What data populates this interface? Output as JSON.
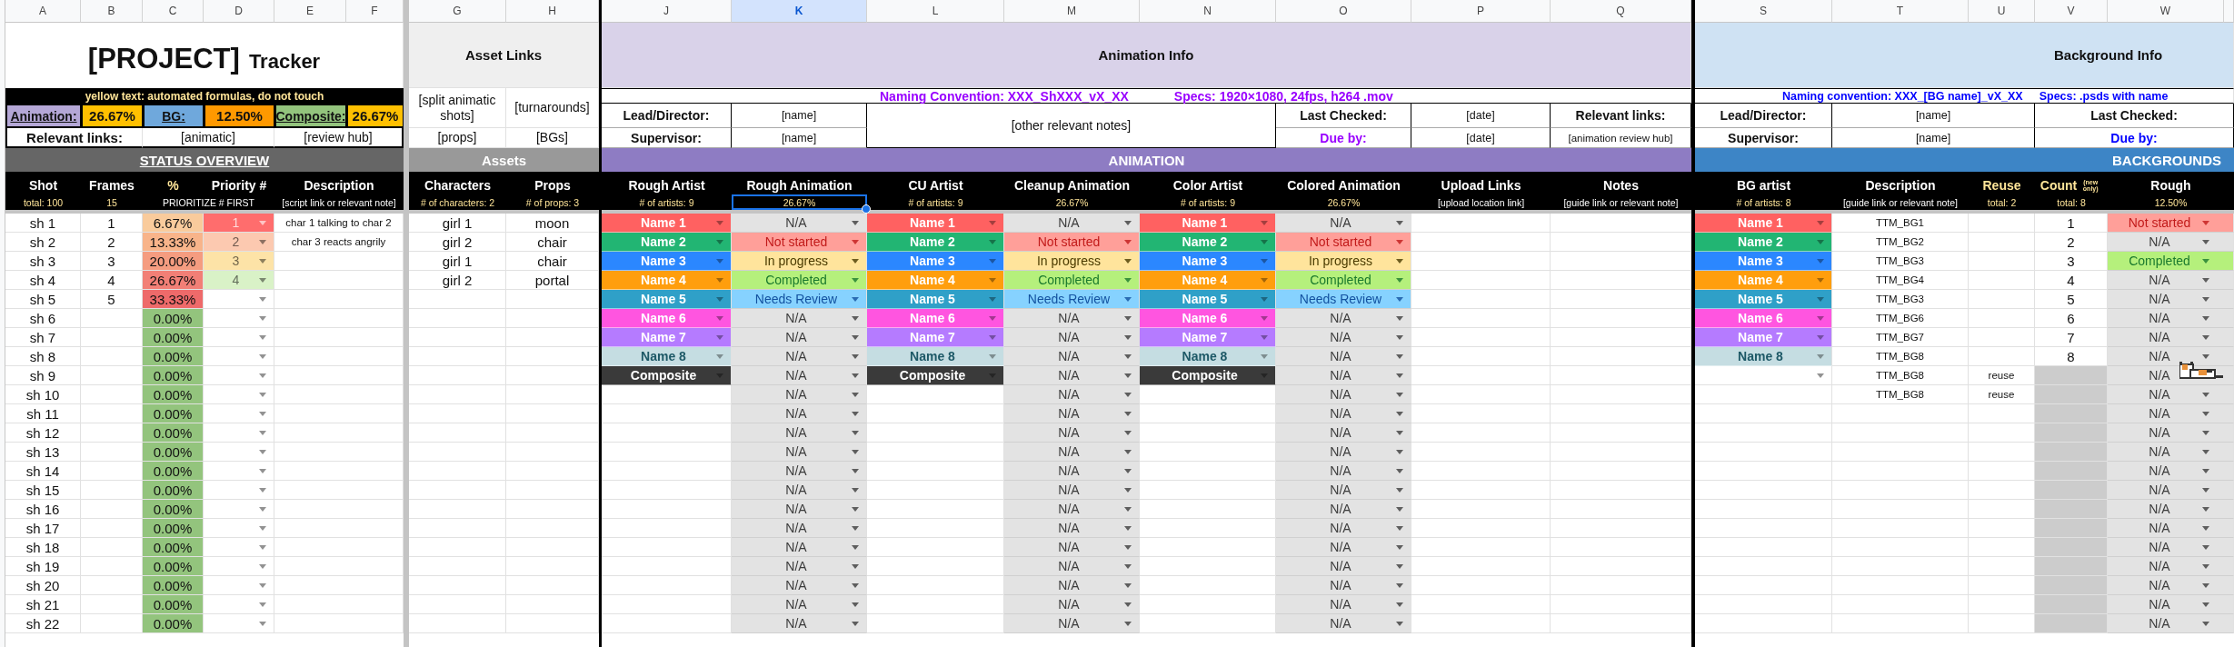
{
  "column_headers": [
    {
      "label": "A",
      "selected": false
    },
    {
      "label": "B",
      "selected": false
    },
    {
      "label": "C",
      "selected": false
    },
    {
      "label": "D",
      "selected": false
    },
    {
      "label": "E",
      "selected": false
    },
    {
      "label": "F",
      "selected": false
    },
    {
      "label": "G",
      "selected": false
    },
    {
      "label": "H",
      "selected": false
    },
    {
      "label": "J",
      "selected": false
    },
    {
      "label": "K",
      "selected": true
    },
    {
      "label": "L",
      "selected": false
    },
    {
      "label": "M",
      "selected": false
    },
    {
      "label": "N",
      "selected": false
    },
    {
      "label": "O",
      "selected": false
    },
    {
      "label": "P",
      "selected": false
    },
    {
      "label": "Q",
      "selected": false
    },
    {
      "label": "S",
      "selected": false
    },
    {
      "label": "T",
      "selected": false
    },
    {
      "label": "U",
      "selected": false
    },
    {
      "label": "V",
      "selected": false
    },
    {
      "label": "W",
      "selected": false
    }
  ],
  "tracker": {
    "title": "[PROJECT]",
    "subtitle": "Tracker",
    "notice": "yellow text: automated formulas, do not touch",
    "progress": [
      {
        "kind": "label",
        "text": "Animation:",
        "color": "#b4a7d6"
      },
      {
        "kind": "value",
        "text": "26.67%",
        "color": "#ffc000"
      },
      {
        "kind": "label",
        "text": "BG:",
        "color": "#6fa8dc"
      },
      {
        "kind": "value",
        "text": "12.50%",
        "color": "#ff9900"
      },
      {
        "kind": "label",
        "text": "Composite:",
        "color": "#93c47d"
      },
      {
        "kind": "value",
        "text": "26.67%",
        "color": "#ffc000"
      }
    ],
    "links_label": "Relevant links:",
    "links": [
      "[animatic]",
      "[review hub]"
    ],
    "section": "STATUS OVERVIEW",
    "headers": [
      {
        "title": "Shot",
        "formula": false
      },
      {
        "title": "Frames",
        "formula": false
      },
      {
        "title": "%",
        "formula": true
      },
      {
        "title": "Priority #",
        "formula": false
      },
      {
        "title": "Description",
        "formula": false
      }
    ],
    "subheaders": [
      {
        "text": "total: 100",
        "formula": true
      },
      {
        "text": "15",
        "formula": true
      },
      {
        "text": "PRIORITIZE # FIRST",
        "formula": false
      },
      {
        "text": "[script link or relevant note]",
        "formula": false
      }
    ]
  },
  "assets": {
    "title": "Asset Links",
    "links": [
      "[split animatic shots]",
      "[turnarounds]",
      "[props]",
      "[BGs]"
    ],
    "section": "Assets",
    "headers": [
      {
        "title": "Characters",
        "formula": false
      },
      {
        "title": "Props",
        "formula": false
      }
    ],
    "subheaders": [
      {
        "text": "# of characters: 2",
        "formula": true
      },
      {
        "text": "# of props: 3",
        "formula": true
      }
    ]
  },
  "animation": {
    "title": "Animation Info",
    "naming": "Naming Convention: XXX_ShXXX_vX_XX",
    "specs": "Specs: 1920×1080, 24fps, h264 .mov",
    "lead_label": "Lead/Director:",
    "lead": "[name]",
    "notes": "[other relevant notes]",
    "last_checked_label": "Last Checked:",
    "last_checked": "[date]",
    "links_label": "Relevant links:",
    "supervisor_label": "Supervisor:",
    "supervisor": "[name]",
    "due_label": "Due by:",
    "due": "[date]",
    "links": "[animation review hub]",
    "section": "ANIMATION",
    "headers": [
      {
        "title": "Rough Artist",
        "formula": false
      },
      {
        "title": "Rough Animation",
        "formula": false
      },
      {
        "title": "CU Artist",
        "formula": false
      },
      {
        "title": "Cleanup Animation",
        "formula": false
      },
      {
        "title": "Color Artist",
        "formula": false
      },
      {
        "title": "Colored Animation",
        "formula": false
      },
      {
        "title": "Upload Links",
        "formula": false
      },
      {
        "title": "Notes",
        "formula": false
      }
    ],
    "subheaders": [
      {
        "text": "# of artists: 9",
        "formula": true
      },
      {
        "text": "26.67%",
        "formula": true
      },
      {
        "text": "# of artists: 9",
        "formula": true
      },
      {
        "text": "26.67%",
        "formula": true
      },
      {
        "text": "# of artists: 9",
        "formula": true
      },
      {
        "text": "26.67%",
        "formula": true
      },
      {
        "text": "[upload location link]",
        "formula": false
      },
      {
        "text": "[guide link or relevant note]",
        "formula": false
      }
    ]
  },
  "background": {
    "title": "Background Info",
    "naming": "Naming convention: XXX_[BG name]_vX_XX",
    "specs": "Specs: .psds with name",
    "lead_label": "Lead/Director:",
    "lead": "[name]",
    "last_checked_label": "Last Checked:",
    "supervisor_label": "Supervisor:",
    "supervisor": "[name]",
    "due_label": "Due by:",
    "section": "BACKGROUNDS",
    "headers": [
      {
        "title": "BG artist",
        "formula": false
      },
      {
        "title": "Description",
        "formula": false
      },
      {
        "title": "Reuse",
        "formula": true
      },
      {
        "title": "Count",
        "note": "(new only)",
        "formula": true
      },
      {
        "title": "Rough",
        "formula": false
      }
    ],
    "subheaders": [
      {
        "text": "# of artists: 8",
        "formula": true
      },
      {
        "text": "[guide link or relevant note]",
        "formula": false
      },
      {
        "text": "total: 2",
        "formula": true
      },
      {
        "text": "total: 8",
        "formula": true
      },
      {
        "text": "12.50%",
        "formula": true
      }
    ]
  },
  "rows": [
    {
      "shot": "sh 1",
      "frames": "1",
      "percent": {
        "text": "6.67%",
        "color": "#f9cb9c"
      },
      "priority": {
        "text": "1",
        "color": "#ff6d6d"
      },
      "description": "char 1 talking to char 2",
      "character": "girl 1",
      "prop": "moon",
      "anim": [
        {
          "kind": "artist",
          "text": "Name 1",
          "color": "#ff6161"
        },
        {
          "kind": "na",
          "text": "N/A"
        },
        {
          "kind": "artist",
          "text": "Name 1",
          "color": "#ff6161"
        },
        {
          "kind": "na",
          "text": "N/A"
        },
        {
          "kind": "artist",
          "text": "Name 1",
          "color": "#ff6161"
        },
        {
          "kind": "na",
          "text": "N/A"
        }
      ],
      "bg": {
        "artist": {
          "kind": "artist",
          "text": "Name 1",
          "color": "#ff6161"
        },
        "description": "TTM_BG1",
        "count": "1",
        "rough": {
          "kind": "not_started",
          "text": "Not started"
        }
      }
    },
    {
      "shot": "sh 2",
      "frames": "2",
      "percent": {
        "text": "13.33%",
        "color": "#f8b48a"
      },
      "priority": {
        "text": "2",
        "color": "#fcc9b0"
      },
      "description": "char 3 reacts angrily",
      "character": "girl 2",
      "prop": "chair",
      "anim": [
        {
          "kind": "artist",
          "text": "Name 2",
          "color": "#22b573"
        },
        {
          "kind": "not_started",
          "text": "Not started"
        },
        {
          "kind": "artist",
          "text": "Name 2",
          "color": "#22b573"
        },
        {
          "kind": "not_started",
          "text": "Not started"
        },
        {
          "kind": "artist",
          "text": "Name 2",
          "color": "#22b573"
        },
        {
          "kind": "not_started",
          "text": "Not started"
        }
      ],
      "bg": {
        "artist": {
          "kind": "artist",
          "text": "Name 2",
          "color": "#22b573"
        },
        "description": "TTM_BG2",
        "count": "2",
        "rough": {
          "kind": "na",
          "text": "N/A"
        }
      }
    },
    {
      "shot": "sh 3",
      "frames": "3",
      "percent": {
        "text": "20.00%",
        "color": "#f59c80"
      },
      "priority": {
        "text": "3",
        "color": "#fde3a7"
      },
      "character": "girl 1",
      "prop": "chair",
      "anim": [
        {
          "kind": "artist",
          "text": "Name 3",
          "color": "#2b87ff"
        },
        {
          "kind": "in_progress",
          "text": "In progress"
        },
        {
          "kind": "artist",
          "text": "Name 3",
          "color": "#2b87ff"
        },
        {
          "kind": "in_progress",
          "text": "In progress"
        },
        {
          "kind": "artist",
          "text": "Name 3",
          "color": "#2b87ff"
        },
        {
          "kind": "in_progress",
          "text": "In progress"
        }
      ],
      "bg": {
        "artist": {
          "kind": "artist",
          "text": "Name 3",
          "color": "#2b87ff"
        },
        "description": "TTM_BG3",
        "count": "3",
        "rough": {
          "kind": "completed",
          "text": "Completed"
        }
      }
    },
    {
      "shot": "sh 4",
      "frames": "4",
      "percent": {
        "text": "26.67%",
        "color": "#f27f76"
      },
      "priority": {
        "text": "4",
        "color": "#d9f2c7"
      },
      "character": "girl 2",
      "prop": "portal",
      "anim": [
        {
          "kind": "artist",
          "text": "Name 4",
          "color": "#ff9e0d"
        },
        {
          "kind": "completed",
          "text": "Completed"
        },
        {
          "kind": "artist",
          "text": "Name 4",
          "color": "#ff9e0d"
        },
        {
          "kind": "completed",
          "text": "Completed"
        },
        {
          "kind": "artist",
          "text": "Name 4",
          "color": "#ff9e0d"
        },
        {
          "kind": "completed",
          "text": "Completed"
        }
      ],
      "bg": {
        "artist": {
          "kind": "artist",
          "text": "Name 4",
          "color": "#ff9e0d"
        },
        "description": "TTM_BG4",
        "count": "4",
        "rough": {
          "kind": "na",
          "text": "N/A"
        }
      }
    },
    {
      "shot": "sh 5",
      "frames": "5",
      "percent": {
        "text": "33.33%",
        "color": "#ee6a6a"
      },
      "anim": [
        {
          "kind": "artist",
          "text": "Name 5",
          "color": "#2fa0c8"
        },
        {
          "kind": "needs_review",
          "text": "Needs Review"
        },
        {
          "kind": "artist",
          "text": "Name 5",
          "color": "#2fa0c8"
        },
        {
          "kind": "needs_review",
          "text": "Needs Review"
        },
        {
          "kind": "artist",
          "text": "Name 5",
          "color": "#2fa0c8"
        },
        {
          "kind": "needs_review",
          "text": "Needs Review"
        }
      ],
      "bg": {
        "artist": {
          "kind": "artist",
          "text": "Name 5",
          "color": "#2fa0c8"
        },
        "description": "TTM_BG3",
        "count": "5",
        "rough": {
          "kind": "na",
          "text": "N/A"
        }
      }
    },
    {
      "shot": "sh 6",
      "percent": {
        "text": "0.00%",
        "color": "#93c47d"
      },
      "anim": [
        {
          "kind": "artist",
          "text": "Name 6",
          "color": "#ff55e0"
        },
        {
          "kind": "na",
          "text": "N/A"
        },
        {
          "kind": "artist",
          "text": "Name 6",
          "color": "#ff55e0"
        },
        {
          "kind": "na",
          "text": "N/A"
        },
        {
          "kind": "artist",
          "text": "Name 6",
          "color": "#ff55e0"
        },
        {
          "kind": "na",
          "text": "N/A"
        }
      ],
      "bg": {
        "artist": {
          "kind": "artist",
          "text": "Name 6",
          "color": "#ff55e0"
        },
        "description": "TTM_BG6",
        "count": "6",
        "rough": {
          "kind": "na",
          "text": "N/A"
        }
      }
    },
    {
      "shot": "sh 7",
      "percent": {
        "text": "0.00%",
        "color": "#93c47d"
      },
      "anim": [
        {
          "kind": "artist",
          "text": "Name 7",
          "color": "#b57bff"
        },
        {
          "kind": "na",
          "text": "N/A"
        },
        {
          "kind": "artist",
          "text": "Name 7",
          "color": "#b57bff"
        },
        {
          "kind": "na",
          "text": "N/A"
        },
        {
          "kind": "artist",
          "text": "Name 7",
          "color": "#b57bff"
        },
        {
          "kind": "na",
          "text": "N/A"
        }
      ],
      "bg": {
        "artist": {
          "kind": "artist",
          "text": "Name 7",
          "color": "#b57bff"
        },
        "description": "TTM_BG7",
        "count": "7",
        "rough": {
          "kind": "na",
          "text": "N/A"
        }
      }
    },
    {
      "shot": "sh 8",
      "percent": {
        "text": "0.00%",
        "color": "#93c47d"
      },
      "anim": [
        {
          "kind": "artist",
          "text": "Name 8",
          "color": "#c5dde2"
        },
        {
          "kind": "na",
          "text": "N/A"
        },
        {
          "kind": "artist",
          "text": "Name 8",
          "color": "#c5dde2"
        },
        {
          "kind": "na",
          "text": "N/A"
        },
        {
          "kind": "artist",
          "text": "Name 8",
          "color": "#c5dde2"
        },
        {
          "kind": "na",
          "text": "N/A"
        }
      ],
      "bg": {
        "artist": {
          "kind": "artist",
          "text": "Name 8",
          "color": "#c5dde2"
        },
        "description": "TTM_BG8",
        "count": "8",
        "rough": {
          "kind": "na",
          "text": "N/A"
        }
      }
    },
    {
      "shot": "sh 9",
      "percent": {
        "text": "0.00%",
        "color": "#93c47d"
      },
      "anim": [
        {
          "kind": "artist",
          "text": "Composite",
          "color": "#3a3a3a"
        },
        {
          "kind": "na",
          "text": "N/A"
        },
        {
          "kind": "artist",
          "text": "Composite",
          "color": "#3a3a3a"
        },
        {
          "kind": "na",
          "text": "N/A"
        },
        {
          "kind": "artist",
          "text": "Composite",
          "color": "#3a3a3a"
        },
        {
          "kind": "na",
          "text": "N/A"
        }
      ],
      "bg": {
        "artist": {
          "kind": "dropdown"
        },
        "description": "TTM_BG8",
        "reuse": "reuse",
        "rough": {
          "kind": "na",
          "text": "N/A"
        }
      }
    },
    {
      "shot": "sh 10",
      "percent": {
        "text": "0.00%",
        "color": "#93c47d"
      },
      "anim": [
        {
          "kind": "blank"
        },
        {
          "kind": "na",
          "text": "N/A"
        },
        {
          "kind": "blank"
        },
        {
          "kind": "na",
          "text": "N/A"
        },
        {
          "kind": "blank"
        },
        {
          "kind": "na",
          "text": "N/A"
        }
      ],
      "bg": {
        "description": "TTM_BG8",
        "reuse": "reuse",
        "rough": {
          "kind": "na",
          "text": "N/A"
        }
      }
    },
    {
      "shot": "sh 11",
      "percent": {
        "text": "0.00%",
        "color": "#93c47d"
      },
      "anim": [
        {
          "kind": "blank"
        },
        {
          "kind": "na",
          "text": "N/A"
        },
        {
          "kind": "blank"
        },
        {
          "kind": "na",
          "text": "N/A"
        },
        {
          "kind": "blank"
        },
        {
          "kind": "na",
          "text": "N/A"
        }
      ],
      "bg": {
        "rough": {
          "kind": "na",
          "text": "N/A"
        }
      }
    },
    {
      "shot": "sh 12",
      "percent": {
        "text": "0.00%",
        "color": "#93c47d"
      },
      "anim": [
        {
          "kind": "blank"
        },
        {
          "kind": "na",
          "text": "N/A"
        },
        {
          "kind": "blank"
        },
        {
          "kind": "na",
          "text": "N/A"
        },
        {
          "kind": "blank"
        },
        {
          "kind": "na",
          "text": "N/A"
        }
      ],
      "bg": {
        "rough": {
          "kind": "na",
          "text": "N/A"
        }
      }
    },
    {
      "shot": "sh 13",
      "percent": {
        "text": "0.00%",
        "color": "#93c47d"
      },
      "anim": [
        {
          "kind": "blank"
        },
        {
          "kind": "na",
          "text": "N/A"
        },
        {
          "kind": "blank"
        },
        {
          "kind": "na",
          "text": "N/A"
        },
        {
          "kind": "blank"
        },
        {
          "kind": "na",
          "text": "N/A"
        }
      ],
      "bg": {
        "rough": {
          "kind": "na",
          "text": "N/A"
        }
      }
    },
    {
      "shot": "sh 14",
      "percent": {
        "text": "0.00%",
        "color": "#93c47d"
      },
      "anim": [
        {
          "kind": "blank"
        },
        {
          "kind": "na",
          "text": "N/A"
        },
        {
          "kind": "blank"
        },
        {
          "kind": "na",
          "text": "N/A"
        },
        {
          "kind": "blank"
        },
        {
          "kind": "na",
          "text": "N/A"
        }
      ],
      "bg": {
        "rough": {
          "kind": "na",
          "text": "N/A"
        }
      }
    },
    {
      "shot": "sh 15",
      "percent": {
        "text": "0.00%",
        "color": "#93c47d"
      },
      "anim": [
        {
          "kind": "blank"
        },
        {
          "kind": "na",
          "text": "N/A"
        },
        {
          "kind": "blank"
        },
        {
          "kind": "na",
          "text": "N/A"
        },
        {
          "kind": "blank"
        },
        {
          "kind": "na",
          "text": "N/A"
        }
      ],
      "bg": {
        "rough": {
          "kind": "na",
          "text": "N/A"
        }
      }
    },
    {
      "shot": "sh 16",
      "percent": {
        "text": "0.00%",
        "color": "#93c47d"
      },
      "anim": [
        {
          "kind": "blank"
        },
        {
          "kind": "na",
          "text": "N/A"
        },
        {
          "kind": "blank"
        },
        {
          "kind": "na",
          "text": "N/A"
        },
        {
          "kind": "blank"
        },
        {
          "kind": "na",
          "text": "N/A"
        }
      ],
      "bg": {
        "rough": {
          "kind": "na",
          "text": "N/A"
        }
      }
    },
    {
      "shot": "sh 17",
      "percent": {
        "text": "0.00%",
        "color": "#93c47d"
      },
      "anim": [
        {
          "kind": "blank"
        },
        {
          "kind": "na",
          "text": "N/A"
        },
        {
          "kind": "blank"
        },
        {
          "kind": "na",
          "text": "N/A"
        },
        {
          "kind": "blank"
        },
        {
          "kind": "na",
          "text": "N/A"
        }
      ],
      "bg": {
        "rough": {
          "kind": "na",
          "text": "N/A"
        }
      }
    },
    {
      "shot": "sh 18",
      "percent": {
        "text": "0.00%",
        "color": "#93c47d"
      },
      "anim": [
        {
          "kind": "blank"
        },
        {
          "kind": "na",
          "text": "N/A"
        },
        {
          "kind": "blank"
        },
        {
          "kind": "na",
          "text": "N/A"
        },
        {
          "kind": "blank"
        },
        {
          "kind": "na",
          "text": "N/A"
        }
      ],
      "bg": {
        "rough": {
          "kind": "na",
          "text": "N/A"
        }
      }
    },
    {
      "shot": "sh 19",
      "percent": {
        "text": "0.00%",
        "color": "#93c47d"
      },
      "anim": [
        {
          "kind": "blank"
        },
        {
          "kind": "na",
          "text": "N/A"
        },
        {
          "kind": "blank"
        },
        {
          "kind": "na",
          "text": "N/A"
        },
        {
          "kind": "blank"
        },
        {
          "kind": "na",
          "text": "N/A"
        }
      ],
      "bg": {
        "rough": {
          "kind": "na",
          "text": "N/A"
        }
      }
    },
    {
      "shot": "sh 20",
      "percent": {
        "text": "0.00%",
        "color": "#93c47d"
      },
      "anim": [
        {
          "kind": "blank"
        },
        {
          "kind": "na",
          "text": "N/A"
        },
        {
          "kind": "blank"
        },
        {
          "kind": "na",
          "text": "N/A"
        },
        {
          "kind": "blank"
        },
        {
          "kind": "na",
          "text": "N/A"
        }
      ],
      "bg": {
        "rough": {
          "kind": "na",
          "text": "N/A"
        }
      }
    },
    {
      "shot": "sh 21",
      "percent": {
        "text": "0.00%",
        "color": "#93c47d"
      },
      "anim": [
        {
          "kind": "blank"
        },
        {
          "kind": "na",
          "text": "N/A"
        },
        {
          "kind": "blank"
        },
        {
          "kind": "na",
          "text": "N/A"
        },
        {
          "kind": "blank"
        },
        {
          "kind": "na",
          "text": "N/A"
        }
      ],
      "bg": {
        "rough": {
          "kind": "na",
          "text": "N/A"
        }
      }
    },
    {
      "shot": "sh 22",
      "percent": {
        "text": "0.00%",
        "color": "#93c47d"
      },
      "anim": [
        {
          "kind": "blank"
        },
        {
          "kind": "na",
          "text": "N/A"
        },
        {
          "kind": "blank"
        },
        {
          "kind": "na",
          "text": "N/A"
        },
        {
          "kind": "blank"
        },
        {
          "kind": "na",
          "text": "N/A"
        }
      ],
      "bg": {
        "rough": {
          "kind": "na",
          "text": "N/A"
        }
      }
    }
  ]
}
